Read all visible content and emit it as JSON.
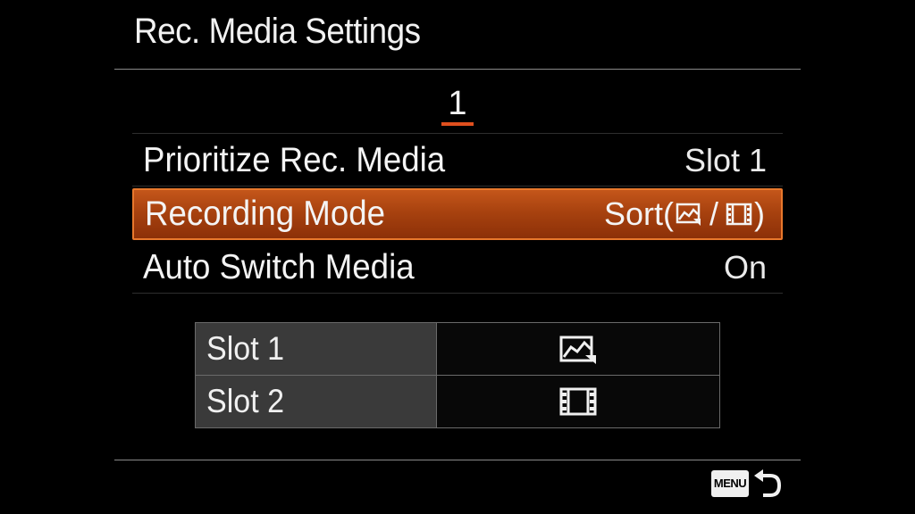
{
  "header": {
    "title": "Rec. Media Settings"
  },
  "pagination": {
    "current_page": "1"
  },
  "menu": {
    "items": [
      {
        "label": "Prioritize Rec. Media",
        "value": "Slot 1",
        "selected": false
      },
      {
        "label": "Recording Mode",
        "value_prefix": "Sort(",
        "value_suffix": ")",
        "value_icons": [
          "photo-icon",
          "movie-icon"
        ],
        "selected": true
      },
      {
        "label": "Auto Switch Media",
        "value": "On",
        "selected": false
      }
    ]
  },
  "slots": {
    "rows": [
      {
        "name": "Slot 1",
        "icon": "photo-icon"
      },
      {
        "name": "Slot 2",
        "icon": "movie-icon"
      }
    ]
  },
  "footer": {
    "menu_button_label": "MENU",
    "back_icon": "return-arrow-icon"
  },
  "colors": {
    "accent": "#e0501e",
    "selection": "#b04812",
    "background": "#000000"
  }
}
